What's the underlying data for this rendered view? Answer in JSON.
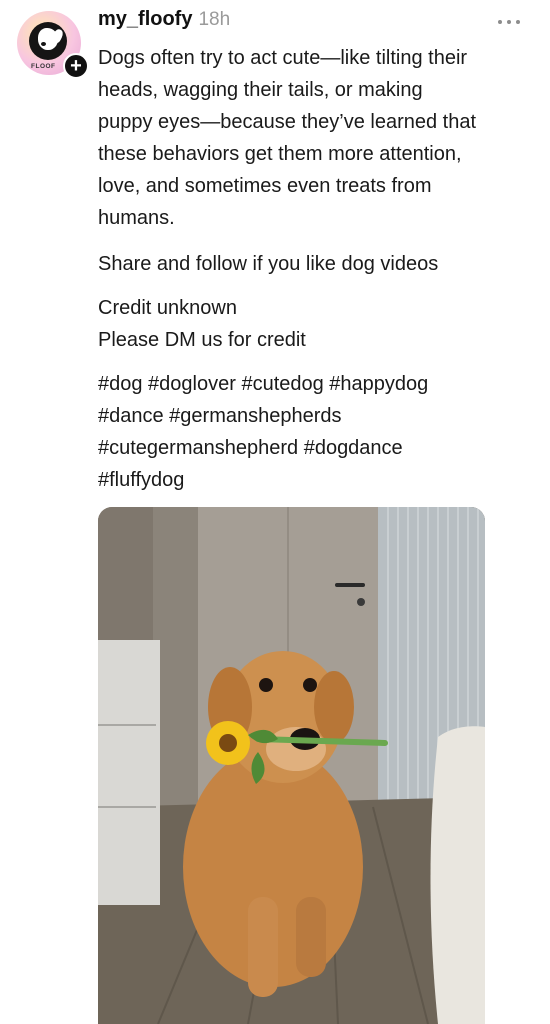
{
  "post": {
    "username": "my_floofy",
    "time_ago": "18h",
    "avatar_brand_text": "FLOOF",
    "follow_symbol": "+",
    "caption_paragraphs": [
      [
        "Dogs often try to act cute—like tilting their",
        "heads, wagging their tails, or making",
        "puppy eyes—because they’ve learned that",
        "these behaviors get them more attention,",
        "love, and sometimes even treats from",
        "humans."
      ],
      [
        "Share and follow if you like dog videos"
      ],
      [
        "Credit unknown",
        "Please DM us for credit"
      ],
      [
        "#dog #doglover #cutedog #happydog",
        "#dance #germanshepherds",
        "#cutegermanshepherd #dogdance",
        "#fluffydog"
      ]
    ],
    "media": {
      "description_icon": "dog-video-thumbnail",
      "colors": {
        "wall": "#8c8277",
        "door": "#a39c93",
        "floor": "#6f6659",
        "dog": "#c9884a",
        "flower": "#f2c21b"
      }
    }
  },
  "colors": {
    "text": "#1a1a1a",
    "muted": "#9a9a9a",
    "background": "#ffffff"
  }
}
